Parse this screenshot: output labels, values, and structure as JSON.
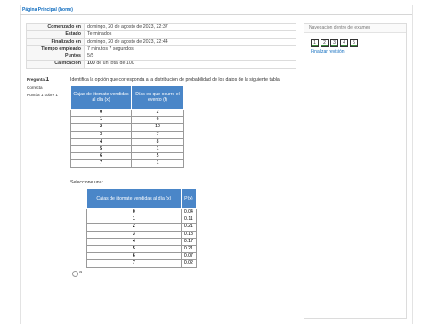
{
  "breadcrumb": "Página Principal (home)",
  "summary": {
    "rows": [
      {
        "label": "Comenzado en",
        "value": "domingo, 20 de agosto de 2023, 22:37"
      },
      {
        "label": "Estado",
        "value": "Terminados"
      },
      {
        "label": "Finalizado en",
        "value": "domingo, 20 de agosto de 2023, 22:44"
      },
      {
        "label": "Tiempo empleado",
        "value": "7 minutos 7 segundos"
      },
      {
        "label": "Puntos",
        "value": "5/5"
      }
    ],
    "grade_label": "Calificación",
    "grade_value": "100",
    "grade_suffix": " de un total de 100"
  },
  "nav": {
    "title": "Navegación dentro del examen",
    "buttons": [
      "1",
      "2",
      "3",
      "4",
      "5"
    ],
    "finish_label": "Finalizar revisión",
    "status_color": "#3a8d3a"
  },
  "question": {
    "label": "Pregunta",
    "number": "1",
    "status": "Correcta",
    "score": "Puntúa 1 sobre 1",
    "text": "Identifica la opción que corresponda a la distribución de probabilidad de los datos de la siguiente tabla.",
    "table": {
      "headers": [
        "Cajas de jitomate vendidas al día (x)",
        "Días en que ocurre el evento (f)"
      ],
      "rows": [
        [
          "0",
          "2"
        ],
        [
          "1",
          "6"
        ],
        [
          "2",
          "10"
        ],
        [
          "3",
          "7"
        ],
        [
          "4",
          "8"
        ],
        [
          "5",
          "1"
        ],
        [
          "6",
          "5"
        ],
        [
          "7",
          "1"
        ]
      ]
    },
    "select_prompt": "Seleccione una:",
    "option_table": {
      "headers": [
        "Cajas de jitomate vendidas al día (x)",
        "P(x)"
      ],
      "rows": [
        [
          "0",
          "0.04"
        ],
        [
          "1",
          "0.11"
        ],
        [
          "2",
          "0.21"
        ],
        [
          "3",
          "0.18"
        ],
        [
          "4",
          "0.17"
        ],
        [
          "5",
          "0.21"
        ],
        [
          "6",
          "0.07"
        ],
        [
          "7",
          "0.02"
        ]
      ]
    },
    "option_label": "a."
  },
  "colors": {
    "header_blue": "#4a86c8",
    "link_blue": "#0f6cbf"
  }
}
